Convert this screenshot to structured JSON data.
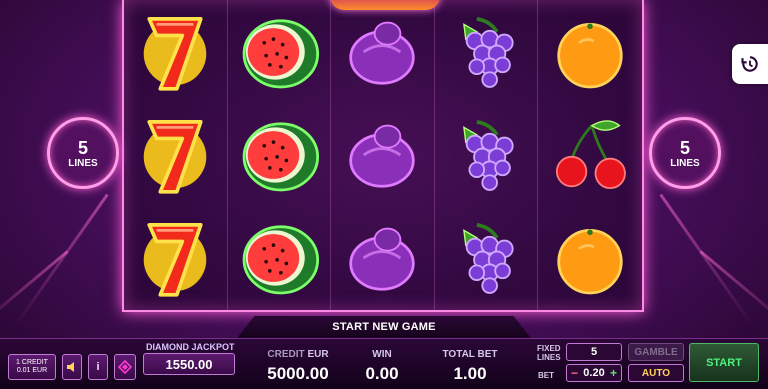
{
  "reels": [
    [
      "seven",
      "seven",
      "seven"
    ],
    [
      "watermelon",
      "watermelon",
      "watermelon"
    ],
    [
      "plum",
      "plum",
      "plum"
    ],
    [
      "grapes",
      "grapes",
      "grapes"
    ],
    [
      "orange",
      "cherry",
      "orange"
    ]
  ],
  "lines_badge": {
    "count": "5",
    "label": "LINES"
  },
  "banner": {
    "start_new_game": "START NEW GAME"
  },
  "controls": {
    "credit_line1": "1 CREDIT",
    "credit_line2": "0.01 EUR",
    "info_label": "i",
    "jackpot_label": "DIAMOND JACKPOT",
    "jackpot_value": "1550.00",
    "credit_label": "CREDIT",
    "credit_currency": "EUR",
    "credit_value": "5000.00",
    "win_label": "WIN",
    "win_value": "0.00",
    "total_bet_label": "TOTAL BET",
    "total_bet_value": "1.00",
    "fixed_lines_label_1": "FIXED",
    "fixed_lines_label_2": "LINES",
    "fixed_lines_value": "5",
    "bet_label": "BET",
    "bet_minus": "−",
    "bet_value": "0.20",
    "bet_plus": "+",
    "gamble_label": "GAMBLE",
    "auto_label": "AUTO",
    "start_label": "START"
  },
  "colors": {
    "background": "#4a0f5e",
    "neon_frame": "#ff8be6",
    "start_green": "#4ff07a",
    "auto_yellow": "#ffd35a"
  },
  "icons": [
    "history-icon",
    "speaker-icon",
    "diamond-icon"
  ]
}
